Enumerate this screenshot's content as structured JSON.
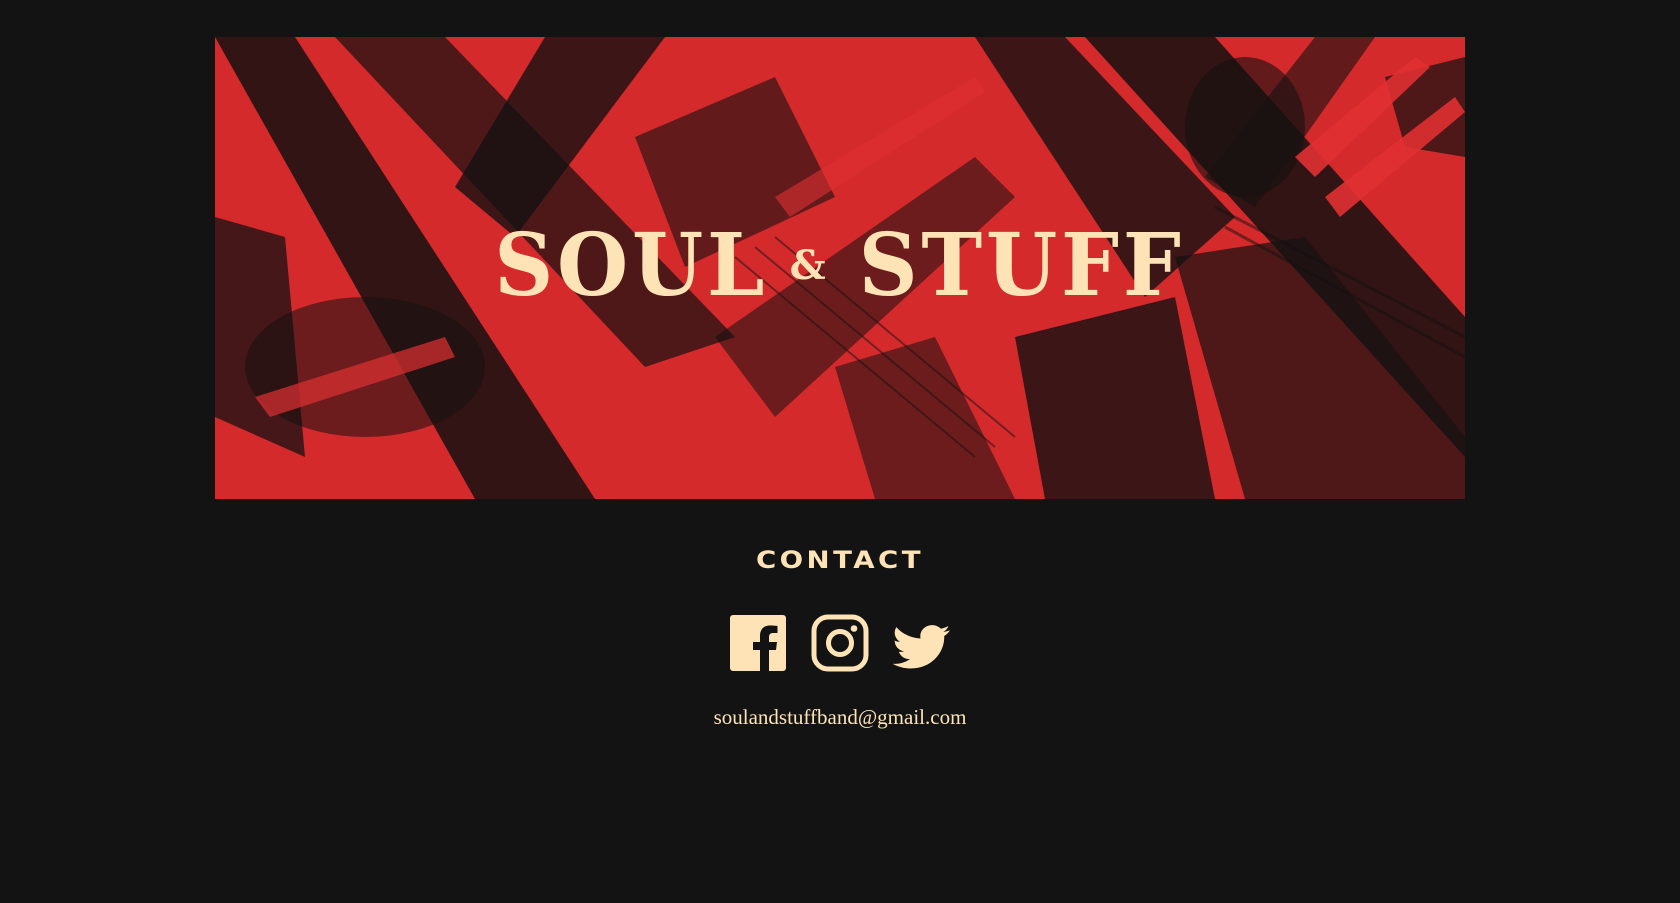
{
  "brand": {
    "logo_text_left": "SOUL",
    "logo_ampersand": "&",
    "logo_text_right": "STUFF"
  },
  "contact": {
    "heading": "CONTACT",
    "email": "soulandstuffband@gmail.com",
    "socials": [
      {
        "name": "facebook",
        "icon": "facebook-icon"
      },
      {
        "name": "instagram",
        "icon": "instagram-icon"
      },
      {
        "name": "twitter",
        "icon": "twitter-icon"
      }
    ]
  },
  "colors": {
    "background": "#131313",
    "accent_red": "#d42a2c",
    "cream": "#fde3b6"
  }
}
